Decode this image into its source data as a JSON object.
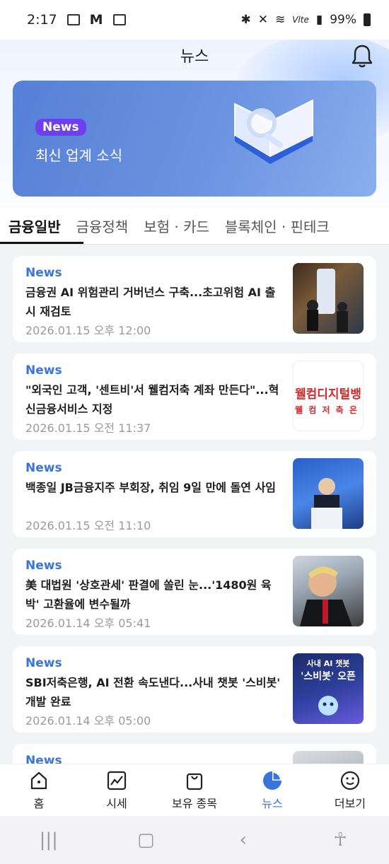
{
  "status_bar": {
    "time": "2:17",
    "battery": "99%",
    "network": "Vlte"
  },
  "header": {
    "title": "뉴스"
  },
  "banner": {
    "badge": "News",
    "subtitle": "최신 업계 소식"
  },
  "tabs": [
    {
      "label": "금융일반",
      "active": true
    },
    {
      "label": "금융정책",
      "active": false
    },
    {
      "label": "보험 · 카드",
      "active": false
    },
    {
      "label": "블록체인 · 핀테크",
      "active": false
    }
  ],
  "articles": [
    {
      "category": "News",
      "headline": "금융권 AI 위험관리 거버넌스 구축...초고위험 AI 출시 재검토",
      "date": "2026.01.15 오후 12:00"
    },
    {
      "category": "News",
      "headline": "\"외국인 고객, '센트비'서 웰컴저축 계좌 만든다\"...혁신금융서비스 지정",
      "date": "2026.01.15 오전 11:37",
      "thumb_text_1": "웰컴디지털뱅",
      "thumb_text_2": "웰 컴 저 축 은"
    },
    {
      "category": "News",
      "headline": "백종일 JB금융지주 부회장, 취임 9일 만에 돌연 사임",
      "date": "2026.01.15 오전 11:10"
    },
    {
      "category": "News",
      "headline": "美 대법원 '상호관세' 판결에 쏠린 눈...'1480원 육박' 고환율에 변수될까",
      "date": "2026.01.14 오후 05:41"
    },
    {
      "category": "News",
      "headline": "SBI저축은행, AI 전환 속도낸다...사내 챗봇 '스비봇' 개발 완료",
      "date": "2026.01.14 오후 05:00",
      "thumb_text_1": "사내 AI 챗봇",
      "thumb_text_2": "'스비봇' 오픈"
    },
    {
      "category": "News",
      "headline": "",
      "date": ""
    }
  ],
  "bottom_nav": [
    {
      "label": "홈",
      "icon": "home-icon",
      "active": false
    },
    {
      "label": "시세",
      "icon": "chart-icon",
      "active": false
    },
    {
      "label": "보유 종목",
      "icon": "bag-icon",
      "active": false
    },
    {
      "label": "뉴스",
      "icon": "pie-icon",
      "active": true
    },
    {
      "label": "더보기",
      "icon": "smile-icon",
      "active": false
    }
  ],
  "colors": {
    "accent": "#3a73d9",
    "badge": "#6d3ff0",
    "banner": "#5f88dc"
  }
}
